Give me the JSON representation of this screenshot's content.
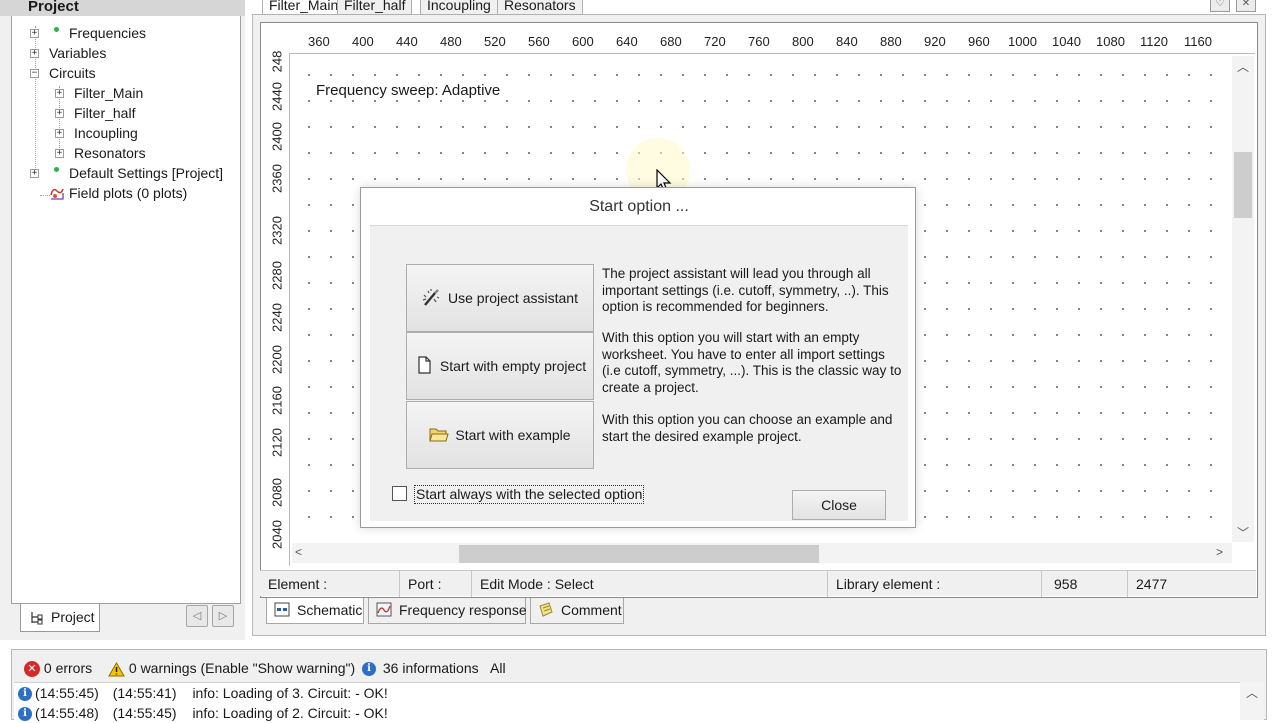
{
  "project_panel": {
    "title": "Project",
    "tree": [
      {
        "label": "Frequencies",
        "expander": "+",
        "dot": true
      },
      {
        "label": "Variables",
        "expander": "+"
      },
      {
        "label": "Circuits",
        "expander": "-"
      },
      {
        "label": "Filter_Main",
        "expander": "+"
      },
      {
        "label": "Filter_half",
        "expander": "+"
      },
      {
        "label": "Incoupling",
        "expander": "+"
      },
      {
        "label": "Resonators",
        "expander": "+"
      },
      {
        "label": "Default Settings [Project]",
        "expander": "+",
        "dot": true
      },
      {
        "label": "Field plots (0 plots)",
        "icon": "field-plot-icon"
      }
    ],
    "bottom_tab": "Project"
  },
  "doc_tabs": [
    "Filter_Main",
    "Filter_half",
    "Incoupling",
    "Resonators"
  ],
  "ruler": {
    "x_ticks": [
      "360",
      "400",
      "440",
      "480",
      "520",
      "560",
      "600",
      "640",
      "680",
      "720",
      "760",
      "800",
      "840",
      "880",
      "920",
      "960",
      "1000",
      "1040",
      "1080",
      "1120",
      "1160"
    ],
    "y_ticks": [
      "248",
      "2440",
      "2400",
      "2360",
      "2320",
      "2280",
      "2240",
      "2200",
      "2160",
      "2120",
      "2080",
      "2040"
    ]
  },
  "canvas": {
    "sweep_label": "Frequency sweep: Adaptive"
  },
  "dialog": {
    "title": "Start option ...",
    "options": [
      {
        "label": "Use project assistant",
        "icon": "wizard-icon",
        "description": "The project assistant will lead you through all important settings (i.e. cutoff, symmetry, ..). This option is recommended for beginners."
      },
      {
        "label": "Start with empty project",
        "icon": "blank-page-icon",
        "description": "With this option you will start with an empty worksheet. You have to enter all import settings (i.e cutoff, symmetry, ...). This is the classic way to create a project."
      },
      {
        "label": "Start with example",
        "icon": "open-folder-icon",
        "description": "With this option you can choose an example and start the desired example project."
      }
    ],
    "checkbox_label": "Start always with the selected option",
    "checkbox_checked": false,
    "close_label": "Close"
  },
  "status_bar": {
    "element": "Element :",
    "port": "Port :",
    "edit_mode": "Edit Mode : Select",
    "library_element": "Library element :",
    "x_value": "958",
    "y_value": "2477"
  },
  "bottom_tabs": [
    "Schematic",
    "Frequency response",
    "Comment"
  ],
  "log": {
    "errors": "0 errors",
    "warnings": "0 warnings (Enable \"Show warning\")",
    "informations": "36 informations",
    "all": "All",
    "rows": [
      {
        "time1": "(14:55:45)",
        "time2": "(14:55:41)",
        "msg": "info: Loading of 3. Circuit:  - OK!"
      },
      {
        "time1": "(14:55:48)",
        "time2": "(14:55:45)",
        "msg": "info: Loading of 2. Circuit:  - OK!"
      }
    ]
  },
  "colors": {
    "error": "#d42a2a",
    "warning": "#f5c400",
    "info": "#2e6fc4",
    "tree_dot": "#2bb24c"
  }
}
